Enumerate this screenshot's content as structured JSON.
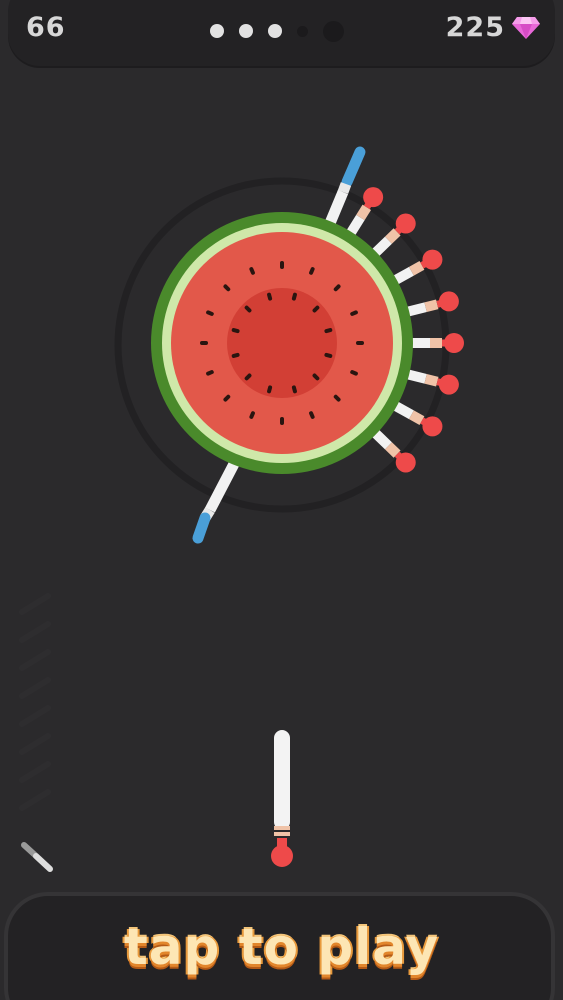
{
  "hud": {
    "score": "66",
    "stage_progress": {
      "completed_stages": 3,
      "total_stages": 4,
      "boss_stage": true
    },
    "gem_count": "225",
    "gem_icon": "pink-diamond"
  },
  "game": {
    "target": "watermelon",
    "knives_in_target": 9,
    "knife_colors": {
      "handle": "#ee4a4a",
      "blade": "#f2f2f2",
      "obstacle_handle": "#4a9fd8"
    },
    "colors": {
      "background": "#2b2a2c",
      "rind": "#4a8a2b",
      "flesh": "#e2584a",
      "flesh_center": "#d23f35",
      "accent_text": "#fde6b4"
    }
  },
  "cta": {
    "label": "tap to play"
  }
}
